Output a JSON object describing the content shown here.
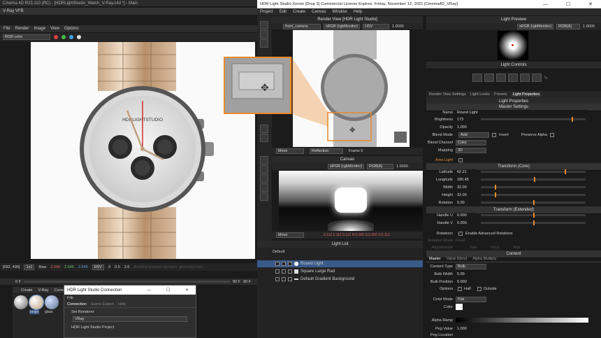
{
  "vfb": {
    "title": "Cinema 4D R23.110 (RC) - [HDRLightStudio_Watch_V-Ray.c4d *] - Main",
    "subtitle": "V-Ray VFB",
    "menu": [
      "File",
      "Render",
      "Image",
      "View",
      "Options"
    ],
    "channel": "RGB color",
    "coords": "[682, 490]",
    "zoom": "1x1",
    "raw_label": "Raw",
    "rgb": [
      "2.646",
      "2.646",
      "2.646"
    ],
    "hsv": "HSV",
    "vals": [
      "0",
      "0.0",
      "2.6"
    ],
    "status": "Building features dynamic geometry tree...",
    "frame_in": "0 F",
    "frame_out": "90 F",
    "watch_brand": "HDRLIGHTSTUDIO"
  },
  "c4d": {
    "tabs": [
      "Create",
      "V-Ray",
      "Conne"
    ],
    "materials": [
      "beige",
      "glass"
    ]
  },
  "conn": {
    "title": "HDR Light Studio Connection",
    "menu": "File",
    "tabs": [
      "Connection",
      "Scene Export",
      "Help"
    ],
    "renderer_label": "Set Renderer",
    "renderer": "VRay",
    "project": "HDR Light Studio Project"
  },
  "hdrls": {
    "title": "HDR Light Studio Xenon [Drop 3] Commercial License Expires: Friday, November 12, 2021 [Cinema4D_VRay]",
    "menu": [
      "Project",
      "Edit",
      "Create",
      "Canvas",
      "Window",
      "Help"
    ],
    "render_view": {
      "title": "Render View [HDR Light Studio]",
      "camera": "front_camera",
      "cs": "sRGB (rgbMonitor)",
      "mode": "HSV",
      "value": "1.0000",
      "move": "Move",
      "reflection": "Reflection",
      "frame": "Frame 0"
    },
    "canvas": {
      "title": "Canvas",
      "cs": "sRGB (rgbMonitor)",
      "ch": "RGB(A)",
      "value": "1.0000",
      "move": "Move",
      "readout": "0.112  0.112  0.112   H:0.000 S:0.000 V:0.112"
    },
    "light_list": {
      "title": "Light List",
      "group": "Default",
      "items": [
        "Round Light",
        "Square Large Rad",
        "Default Gradient Background"
      ]
    },
    "preview": {
      "title": "Light Preview",
      "cs": "sRGB (rgbMonitor)",
      "ch": "RGB(A)",
      "value": "1.0000"
    },
    "controls": {
      "title": "Light Controls"
    },
    "tabs": [
      "Render View Settings",
      "Light Looks",
      "Presets",
      "Light Properties"
    ],
    "props": {
      "title": "Light Properties",
      "master": "Master Settings",
      "name_label": "Name",
      "name": "Round Light",
      "brightness_label": "Brightness",
      "brightness": "173",
      "opacity_label": "Opacity",
      "opacity": "1.000",
      "blend_mode_label": "Blend Mode",
      "blend_mode": "Add",
      "invert": "Invert",
      "preserve_alpha": "Preserve Alpha",
      "blend_channel_label": "Blend Channel",
      "blend_channel": "Color",
      "mapping_label": "Mapping",
      "mapping": "3D",
      "area_light": "Area Light",
      "transform": "Transform (Core)",
      "latitude_label": "Latitude",
      "latitude": "62.21",
      "longitude_label": "Longitude",
      "longitude": "180.45",
      "width_label": "Width",
      "width": "32.00",
      "height_label": "Height",
      "height": "32.00",
      "rotation_label": "Rotation",
      "rotation": "0.00",
      "transform_ext": "Transform (Extended)",
      "handle_u_label": "Handle U",
      "handle_u": "0.000",
      "handle_v_label": "Handle V",
      "handle_v": "0.000",
      "rotations_label": "Rotations",
      "enable_adv": "Enable Advanced Rotations",
      "rotation_mode_label": "Rotation Mode",
      "rotation_mode": "Fixed",
      "adjustments_label": "Adjustments",
      "yaw": "Yaw",
      "pitch": "Pitch",
      "roll": "Roll",
      "content": "Content",
      "content_tabs": [
        "Master",
        "Value Blend",
        "Alpha Multiply"
      ],
      "content_type_label": "Content Type",
      "content_type": "Bulb",
      "bulb_width_label": "Bulb Width",
      "bulb_width": "0.00",
      "bulb_pos_label": "Bulb Position",
      "bulb_pos": "0.000",
      "options_label": "Options",
      "half": "Half",
      "outside": "Outside",
      "color_mode_label": "Color Mode",
      "color_mode": "Flat",
      "color_label": "Color",
      "alpha_ramp_label": "Alpha Ramp",
      "peg_value_label": "Peg Value",
      "peg_value": "1.000",
      "peg_location_label": "Peg Location"
    }
  },
  "colors": {
    "accent": "#e88a2a",
    "select": "#3a5a8a"
  }
}
